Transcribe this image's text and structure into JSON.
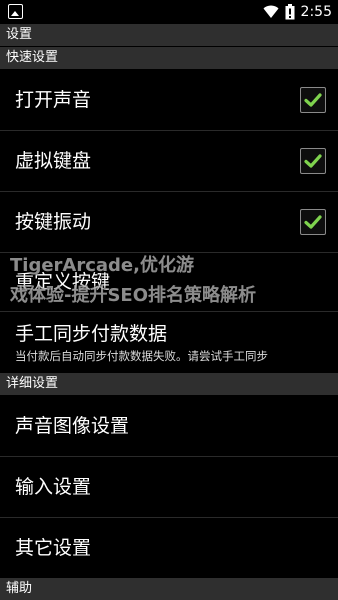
{
  "status_bar": {
    "time": "2:55"
  },
  "sections": {
    "quick": "快速设置",
    "detail": "详细设置",
    "assist": "辅助"
  },
  "title": "设置",
  "quick_items": [
    {
      "label": "打开声音",
      "checked": true
    },
    {
      "label": "虚拟键盘",
      "checked": true
    },
    {
      "label": "按键振动",
      "checked": true
    }
  ],
  "remap": {
    "label": "重定义按键"
  },
  "sync": {
    "label": "手工同步付款数据",
    "summary": "当付款后自动同步付款数据失败。请尝试手工同步"
  },
  "detail_items": [
    {
      "label": "声音图像设置"
    },
    {
      "label": "输入设置"
    },
    {
      "label": "其它设置"
    }
  ],
  "watermark": {
    "line1": "TigerArcade,优化游",
    "line2": "戏体验-提升SEO排名策略解析"
  },
  "colors": {
    "check": "#7fd34e",
    "section_bg": "#2f2f2f",
    "background": "#000000"
  }
}
